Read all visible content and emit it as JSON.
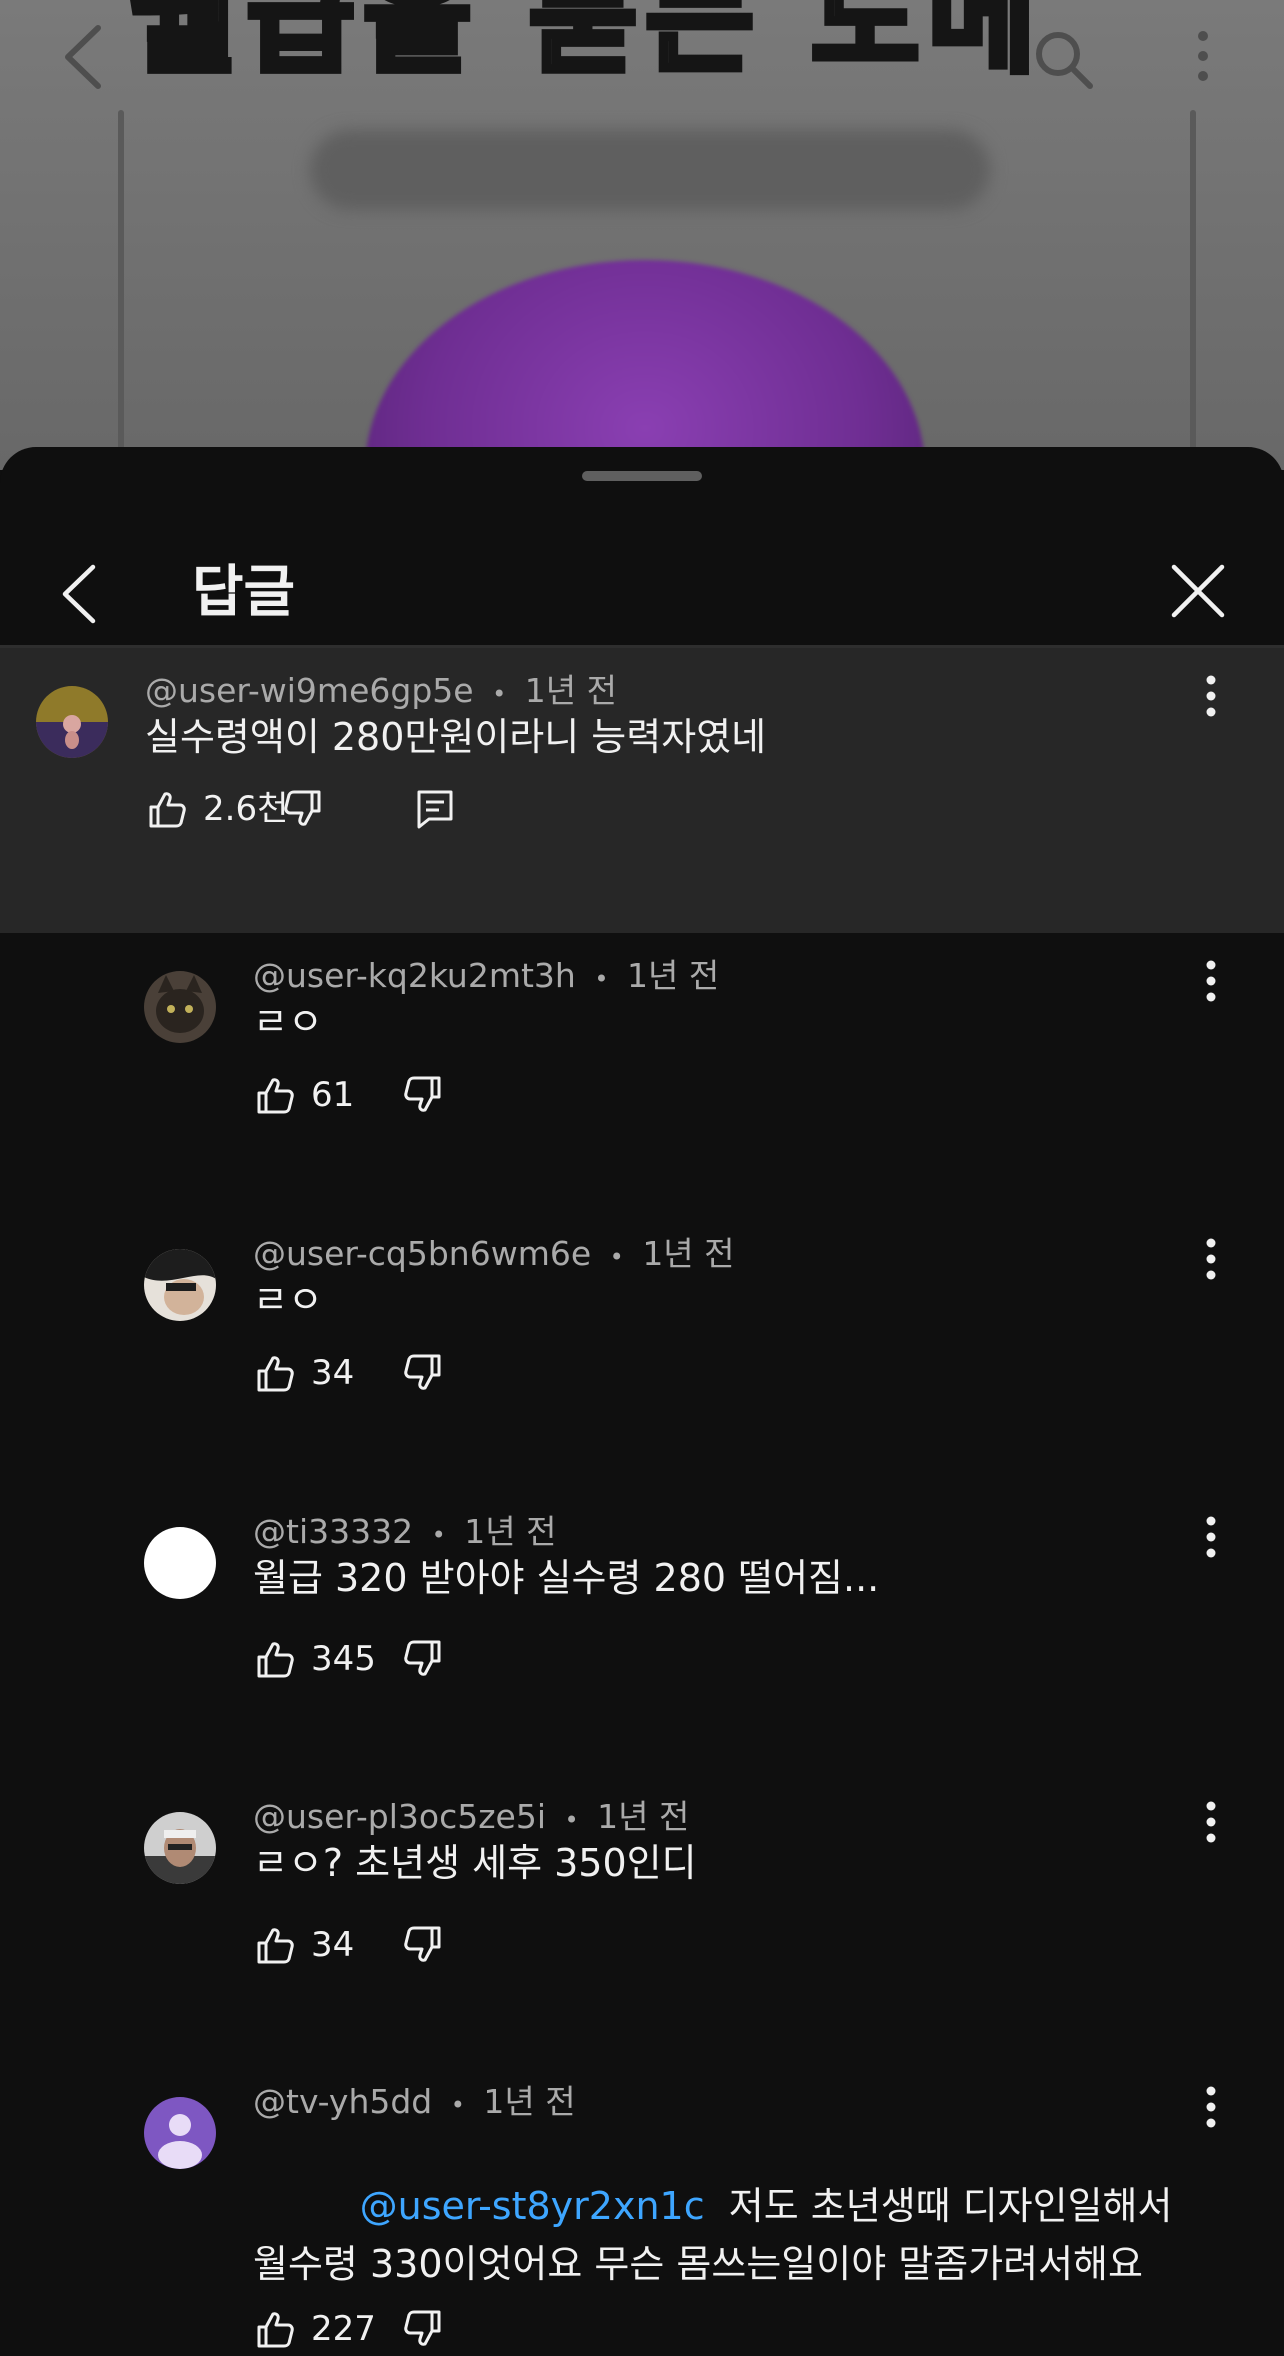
{
  "video": {
    "banner_text": "월급을 묻는 도메"
  },
  "sheet": {
    "title": "답글"
  },
  "parent_comment": {
    "author": "@user-wi9me6gp5e",
    "age": "1년 전",
    "text": "실수령액이 280만원이라니 능력자였네",
    "likes": "2.6천"
  },
  "replies": [
    {
      "author": "@user-kq2ku2mt3h",
      "age": "1년 전",
      "text": "ㄹㅇ",
      "likes": "61"
    },
    {
      "author": "@user-cq5bn6wm6e",
      "age": "1년 전",
      "text": "ㄹㅇ",
      "likes": "34"
    },
    {
      "author": "@ti33332",
      "age": "1년 전",
      "text": "월급 320 받아야 실수령 280 떨어짐...",
      "likes": "345"
    },
    {
      "author": "@user-pl3oc5ze5i",
      "age": "1년 전",
      "text": "ㄹㅇ? 초년생 세후 350인디",
      "likes": "34"
    },
    {
      "author": "@tv-yh5dd",
      "age": "1년 전",
      "mention": "@user-st8yr2xn1c",
      "text": "저도 초년생때 디자인일해서 월수령 330이엇어요 무슨 몸쓰는일이야 말좀가려서해요",
      "likes": "227"
    }
  ],
  "separator": "•",
  "icons": {
    "back": "chevron-left-icon",
    "close": "close-icon",
    "like": "thumbs-up-icon",
    "dislike": "thumbs-down-icon",
    "reply": "reply-icon",
    "more": "kebab-menu-icon",
    "search": "search-icon"
  },
  "colors": {
    "background": "#0f0f0f",
    "parent_highlight": "#272727",
    "mention": "#3ea6ff",
    "secondary_text": "#aaaaaa"
  }
}
